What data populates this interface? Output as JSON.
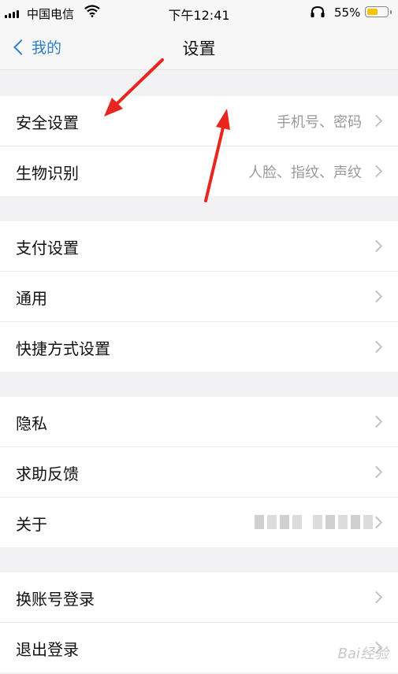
{
  "status_bar": {
    "carrier": "中国电信",
    "time": "下午12:41",
    "battery": "55%",
    "battery_level": 0.55
  },
  "navbar": {
    "back_label": "我的",
    "title": "设置"
  },
  "groups": [
    [
      {
        "label": "安全设置",
        "value": "手机号、密码"
      },
      {
        "label": "生物识别",
        "value": "人脸、指纹、声纹"
      }
    ],
    [
      {
        "label": "支付设置"
      },
      {
        "label": "通用"
      },
      {
        "label": "快捷方式设置"
      }
    ],
    [
      {
        "label": "隐私"
      },
      {
        "label": "求助反馈"
      },
      {
        "label": "关于"
      }
    ],
    [
      {
        "label": "换账号登录"
      },
      {
        "label": "退出登录"
      }
    ]
  ],
  "colors": {
    "accent": "#2f7fc6",
    "annotation": "#e8251f"
  },
  "watermark": "Bai经验"
}
